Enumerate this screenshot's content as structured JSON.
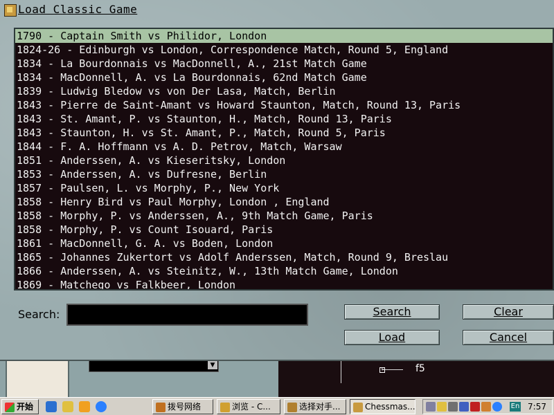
{
  "dialog": {
    "title": "Load Classic Game",
    "search_label": "Search:",
    "search_value": "",
    "buttons": {
      "search": "Search",
      "clear": "Clear",
      "load": "Load",
      "cancel": "Cancel"
    }
  },
  "games": [
    "1790 - Captain Smith vs Philidor, London",
    "1824-26 - Edinburgh vs London, Correspondence Match, Round 5, England",
    "1834 - La Bourdonnais vs MacDonnell, A., 21st Match Game",
    "1834 - MacDonnell, A. vs La Bourdonnais, 62nd Match Game",
    "1839 - Ludwig Bledow vs von Der Lasa, Match, Berlin",
    "1843 - Pierre de Saint-Amant vs Howard Staunton, Match, Round 13, Paris",
    "1843 - St. Amant, P. vs Staunton, H., Match, Round 13, Paris",
    "1843 - Staunton, H. vs St. Amant, P., Match, Round 5, Paris",
    "1844 - F. A. Hoffmann vs A. D. Petrov, Match, Warsaw",
    "1851 - Anderssen, A. vs Kieseritsky, London",
    "1853 - Anderssen, A. vs Dufresne, Berlin",
    "1857 - Paulsen, L. vs Morphy, P., New York",
    "1858 - Henry Bird vs Paul Morphy, London , England",
    "1858 - Morphy, P. vs Anderssen, A., 9th Match Game, Paris",
    "1858 - Morphy, P. vs Count Isouard, Paris",
    "1861 - MacDonnell, G. A. vs Boden, London",
    "1865 - Johannes Zukertort vs Adolf Anderssen, Match, Round 9, Breslau",
    "1866 - Anderssen, A. vs Steinitz, W., 13th Match Game, London",
    "1869 - Matchego vs Falkbeer, London"
  ],
  "selected_index": 0,
  "background": {
    "move_text": "f5"
  },
  "taskbar": {
    "start": "开始",
    "tasks": [
      "拨号网络",
      "浏览 - C...",
      "选择对手...",
      "Chessmas..."
    ],
    "active_task": 3,
    "lang": "En",
    "clock": "7:57"
  },
  "colors": {
    "list_bg": "#170a0e",
    "selected_row": "#a8c4a4",
    "dialog_bg": "#9aacae"
  }
}
